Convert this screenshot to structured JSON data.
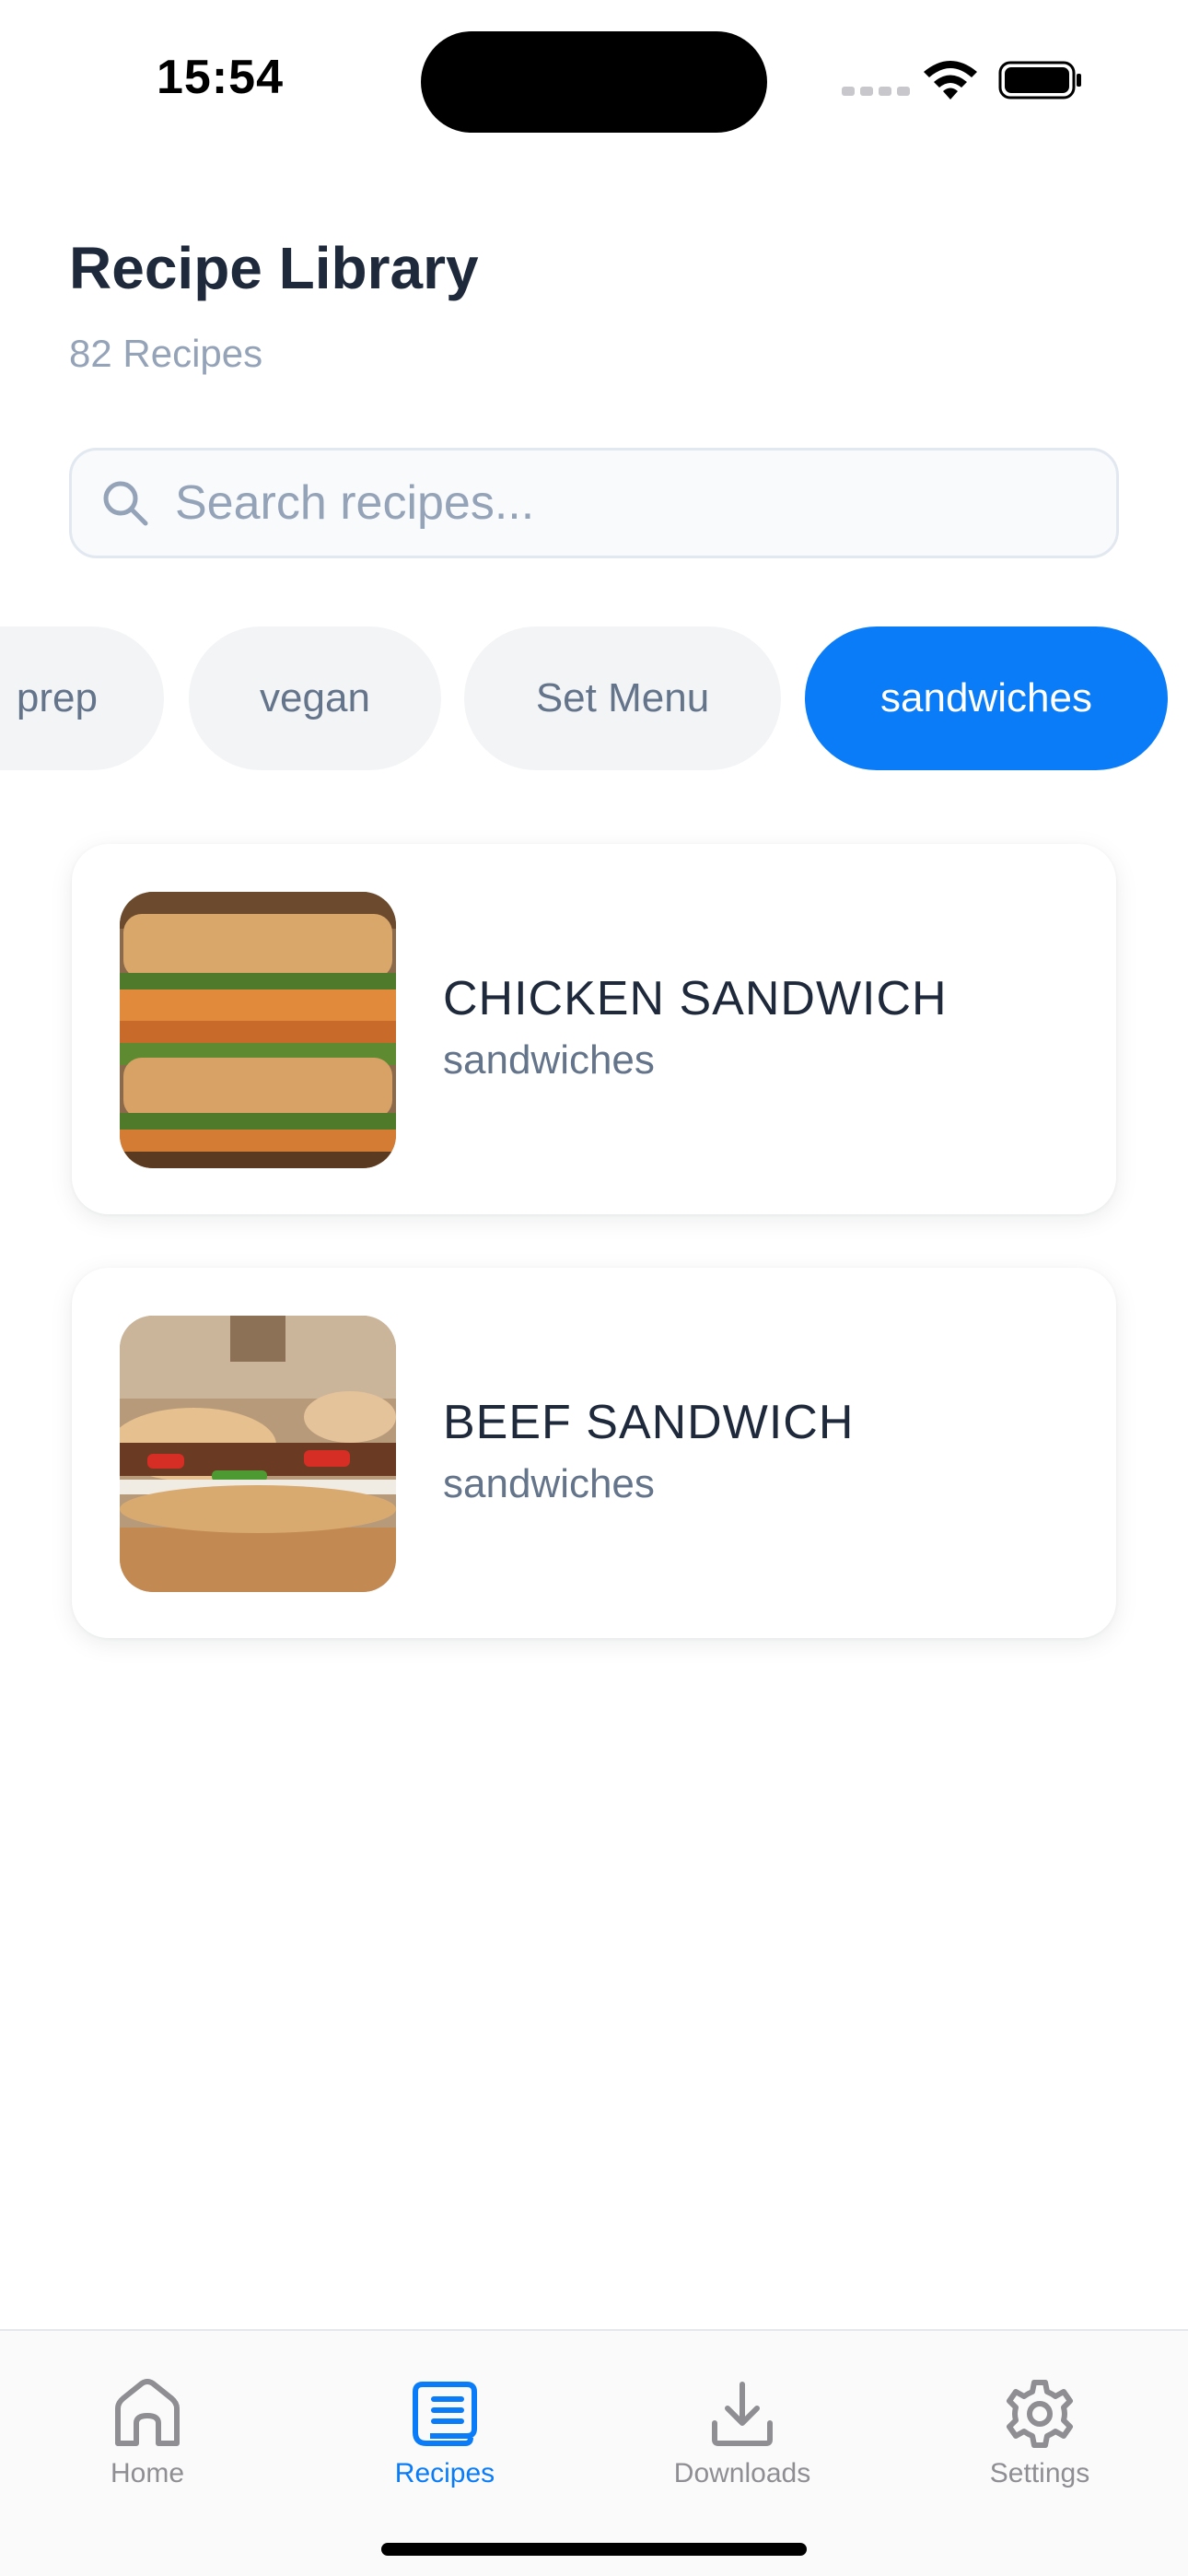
{
  "status_bar": {
    "time": "15:54"
  },
  "header": {
    "title": "Recipe Library",
    "count": "82 Recipes"
  },
  "search": {
    "placeholder": "Search recipes...",
    "value": ""
  },
  "filters": [
    {
      "label": "prep",
      "active": false
    },
    {
      "label": "vegan",
      "active": false
    },
    {
      "label": "Set Menu",
      "active": false
    },
    {
      "label": "sandwiches",
      "active": true
    }
  ],
  "recipes": [
    {
      "title": "CHICKEN SANDWICH",
      "category": "sandwiches"
    },
    {
      "title": "BEEF SANDWICH",
      "category": "sandwiches"
    }
  ],
  "tabs": [
    {
      "label": "Home",
      "icon": "home-icon",
      "active": false
    },
    {
      "label": "Recipes",
      "icon": "recipes-icon",
      "active": true
    },
    {
      "label": "Downloads",
      "icon": "download-icon",
      "active": false
    },
    {
      "label": "Settings",
      "icon": "gear-icon",
      "active": false
    }
  ],
  "colors": {
    "accent": "#0a7cf8",
    "chip_bg": "#f3f4f6",
    "text_primary": "#1e293b",
    "text_muted": "#64748b"
  }
}
